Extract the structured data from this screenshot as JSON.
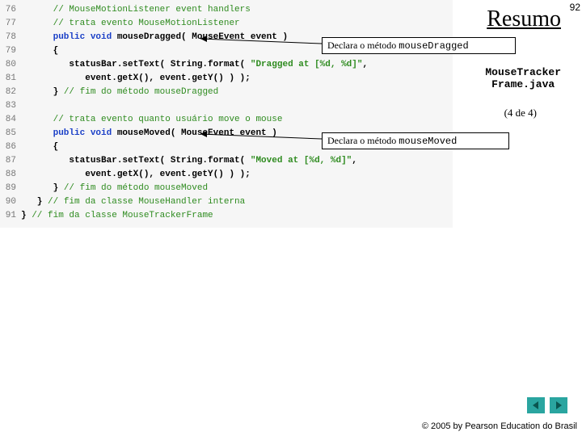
{
  "slide_number": "92",
  "title": "Resumo",
  "file_label": "MouseTracker\nFrame.java",
  "pager": "(4 de 4)",
  "callouts": {
    "dragged_pre": "Declara o método ",
    "dragged_code": "mouseDragged",
    "moved_pre": "Declara o método ",
    "moved_code": "mouseMoved"
  },
  "copyright": "© 2005 by Pearson Education do Brasil",
  "nav": {
    "prev": "prev",
    "next": "next"
  },
  "code": {
    "76": {
      "text": "      // MouseMotionListener event handlers",
      "cls": "cm"
    },
    "77": {
      "text": "      // trata evento MouseMotionListener",
      "cls": "cm"
    },
    "78_kw": "      public void ",
    "78_id": "mouseDragged( MouseEvent event )",
    "79": "      {",
    "80_a": "         statusBar.setText( String.format( ",
    "80_s": "\"Dragged at [%d, %d]\"",
    "80_b": ",",
    "81_a": "            event.getX(), event.getY() ) );",
    "82": {
      "text": "      } // fim do método mouseDragged",
      "cls": "cm",
      "brace": "      } "
    },
    "83": "",
    "84": {
      "text": "      // trata evento quanto usuário move o mouse",
      "cls": "cm"
    },
    "85_kw": "      public void ",
    "85_id": "mouseMoved( MouseEvent event )",
    "86": "      {",
    "87_a": "         statusBar.setText( String.format( ",
    "87_s": "\"Moved at [%d, %d]\"",
    "87_b": ",",
    "88_a": "            event.getX(), event.getY() ) );",
    "89": {
      "text": "// fim do método mouseMoved",
      "brace": "      } "
    },
    "90": {
      "text": "// fim da classe MouseHandler interna",
      "brace": "   } "
    },
    "91": {
      "text": "// fim da classe MouseTrackerFrame",
      "brace": "} "
    }
  }
}
